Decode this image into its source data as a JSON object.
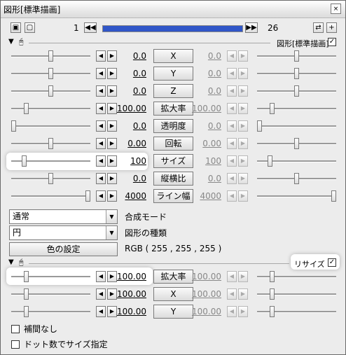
{
  "window": {
    "title": "図形[標準描画]",
    "close_label": "×"
  },
  "toolbar": {
    "frame_start": "1",
    "frame_end": "26",
    "timeline_progress": 1.0,
    "prev_icon": "skip-back-icon",
    "next_icon": "skip-forward-icon"
  },
  "section1": {
    "filter_name": "図形[標準描画]",
    "enabled_check": "✓"
  },
  "params": [
    {
      "label": "X",
      "left_value": "0.0",
      "right_value": "0.0",
      "left_pos": 0.5,
      "right_pos": 0.5
    },
    {
      "label": "Y",
      "left_value": "0.0",
      "right_value": "0.0",
      "left_pos": 0.5,
      "right_pos": 0.5
    },
    {
      "label": "Z",
      "left_value": "0.0",
      "right_value": "0.0",
      "left_pos": 0.5,
      "right_pos": 0.5
    },
    {
      "label": "拡大率",
      "left_value": "100.00",
      "right_value": "100.00",
      "left_pos": 0.17,
      "right_pos": 0.17
    },
    {
      "label": "透明度",
      "left_value": "0.0",
      "right_value": "0.0",
      "left_pos": 0.0,
      "right_pos": 0.0
    },
    {
      "label": "回転",
      "left_value": "0.00",
      "right_value": "0.00",
      "left_pos": 0.5,
      "right_pos": 0.5
    },
    {
      "label": "サイズ",
      "left_value": "100",
      "right_value": "100",
      "left_pos": 0.14,
      "right_pos": 0.14
    },
    {
      "label": "縦横比",
      "left_value": "0.0",
      "right_value": "0.0",
      "left_pos": 0.5,
      "right_pos": 0.5
    },
    {
      "label": "ライン幅",
      "left_value": "4000",
      "right_value": "4000",
      "left_pos": 1.0,
      "right_pos": 1.0
    }
  ],
  "blend": {
    "value": "通常",
    "label": "合成モード"
  },
  "shape": {
    "value": "円",
    "label": "図形の種類"
  },
  "color": {
    "button_label": "色の設定",
    "rgb_text": "RGB ( 255 , 255 , 255 )"
  },
  "section2": {
    "filter_name": "リサイズ",
    "enabled_check": "✓"
  },
  "resize_params": [
    {
      "label": "拡大率",
      "left_value": "100.00",
      "right_value": "100.00",
      "left_pos": 0.17,
      "right_pos": 0.17
    },
    {
      "label": "X",
      "left_value": "100.00",
      "right_value": "100.00",
      "left_pos": 0.17,
      "right_pos": 0.17
    },
    {
      "label": "Y",
      "left_value": "100.00",
      "right_value": "100.00",
      "left_pos": 0.17,
      "right_pos": 0.17
    }
  ],
  "options": [
    {
      "label": "補間なし",
      "checked": false
    },
    {
      "label": "ドット数でサイズ指定",
      "checked": false
    }
  ]
}
